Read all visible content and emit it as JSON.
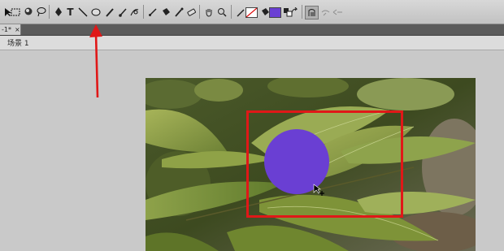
{
  "toolbar": {
    "tools": [
      "selection-tool-icon",
      "subselection-tool-icon",
      "free-transform-icon",
      "gradient-transform-icon",
      "lasso-icon",
      "pen-icon",
      "text-icon",
      "line-icon",
      "oval-tool-icon",
      "pencil-icon",
      "brush-icon",
      "deco-icon",
      "bone-icon",
      "paint-bucket-icon",
      "ink-bottle-icon",
      "eyedropper-icon",
      "eraser-icon",
      "hand-icon",
      "zoom-icon"
    ],
    "text_tool_label": "T",
    "stroke_color": "#2a2a2a",
    "fill_color": "#6a3fd3"
  },
  "tabs": {
    "document_label": "-1*",
    "close_label": "×"
  },
  "scene": {
    "label": "场景 1"
  },
  "colors": {
    "circle": "#6a3fd3",
    "highlight": "#e01818",
    "arrow": "#e01818"
  }
}
